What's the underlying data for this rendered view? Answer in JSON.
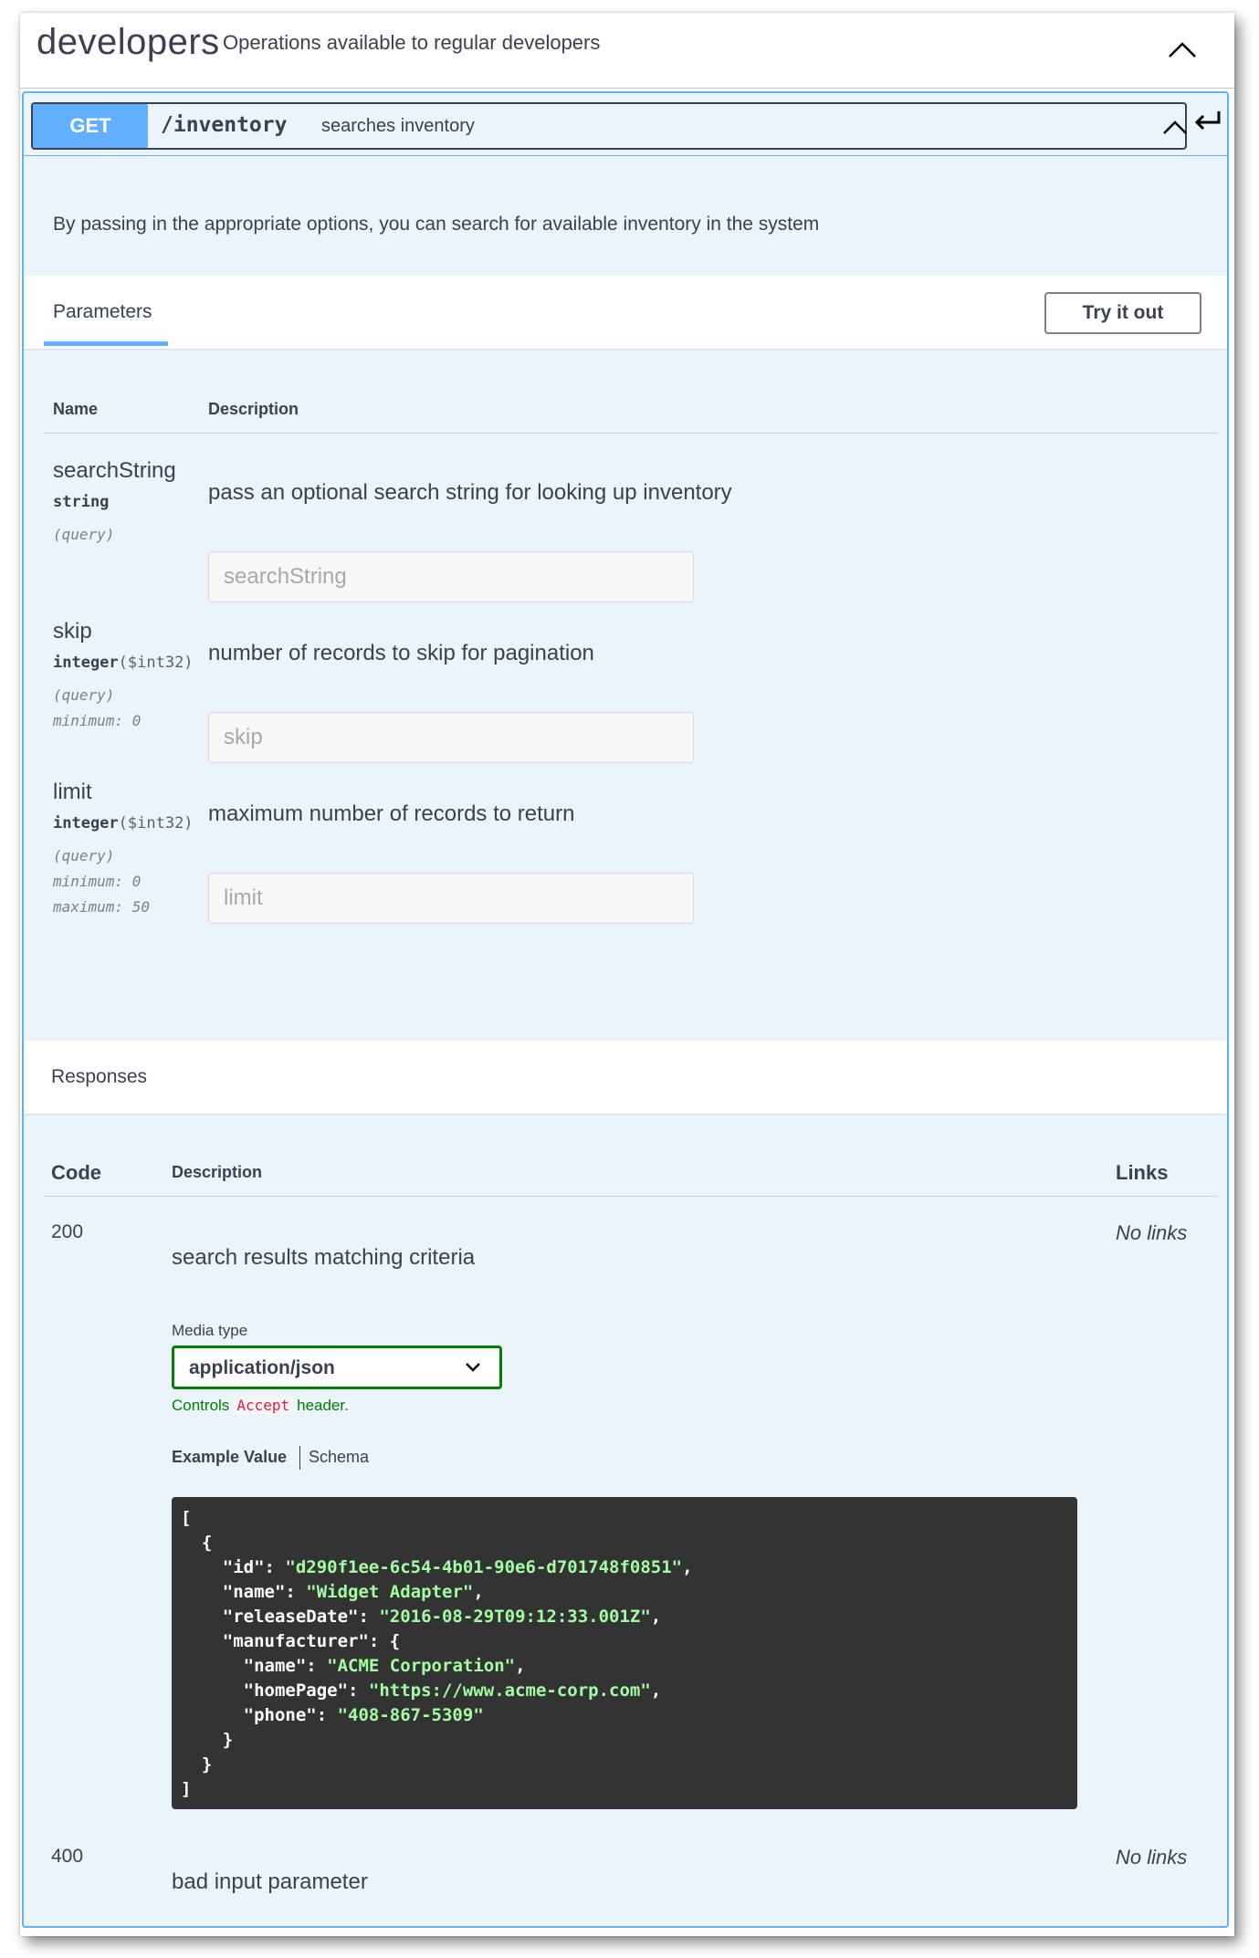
{
  "tag": {
    "name": "developers",
    "description": "Operations available to regular developers"
  },
  "operation": {
    "method": "GET",
    "path": "/inventory",
    "summary": "searches inventory",
    "description": "By passing in the appropriate options, you can search for available inventory in the system"
  },
  "parameters_section": {
    "tab_label": "Parameters",
    "try_button": "Try it out",
    "col_name": "Name",
    "col_description": "Description",
    "items": [
      {
        "name": "searchString",
        "type": "string",
        "format": "",
        "in": "(query)",
        "minimum": "",
        "maximum": "",
        "description": "pass an optional search string for looking up inventory",
        "placeholder": "searchString"
      },
      {
        "name": "skip",
        "type": "integer",
        "format": "($int32)",
        "in": "(query)",
        "minimum": "minimum: 0",
        "maximum": "",
        "description": "number of records to skip for pagination",
        "placeholder": "skip"
      },
      {
        "name": "limit",
        "type": "integer",
        "format": "($int32)",
        "in": "(query)",
        "minimum": "minimum: 0",
        "maximum": "maximum: 50",
        "description": "maximum number of records to return",
        "placeholder": "limit"
      }
    ]
  },
  "responses_section": {
    "title": "Responses",
    "col_code": "Code",
    "col_description": "Description",
    "col_links": "Links",
    "media_type_label": "Media type",
    "media_type_value": "application/json",
    "controls_prefix": "Controls",
    "controls_code": "Accept",
    "controls_suffix": "header.",
    "tab_example": "Example Value",
    "tab_schema": "Schema",
    "items": [
      {
        "code": "200",
        "description": "search results matching criteria",
        "links": "No links"
      },
      {
        "code": "400",
        "description": "bad input parameter",
        "links": "No links"
      }
    ],
    "example": {
      "id": "d290f1ee-6c54-4b01-90e6-d701748f0851",
      "name": "Widget Adapter",
      "releaseDate": "2016-08-29T09:12:33.001Z",
      "manufacturer": {
        "name": "ACME Corporation",
        "homePage": "https://www.acme-corp.com",
        "phone": "408-867-5309"
      }
    }
  },
  "colors": {
    "get_blue": "#61affe",
    "opblock_bg": "#ebf3fb",
    "select_green": "#008000",
    "code_bg": "#333333",
    "code_string": "#a2fca2"
  }
}
